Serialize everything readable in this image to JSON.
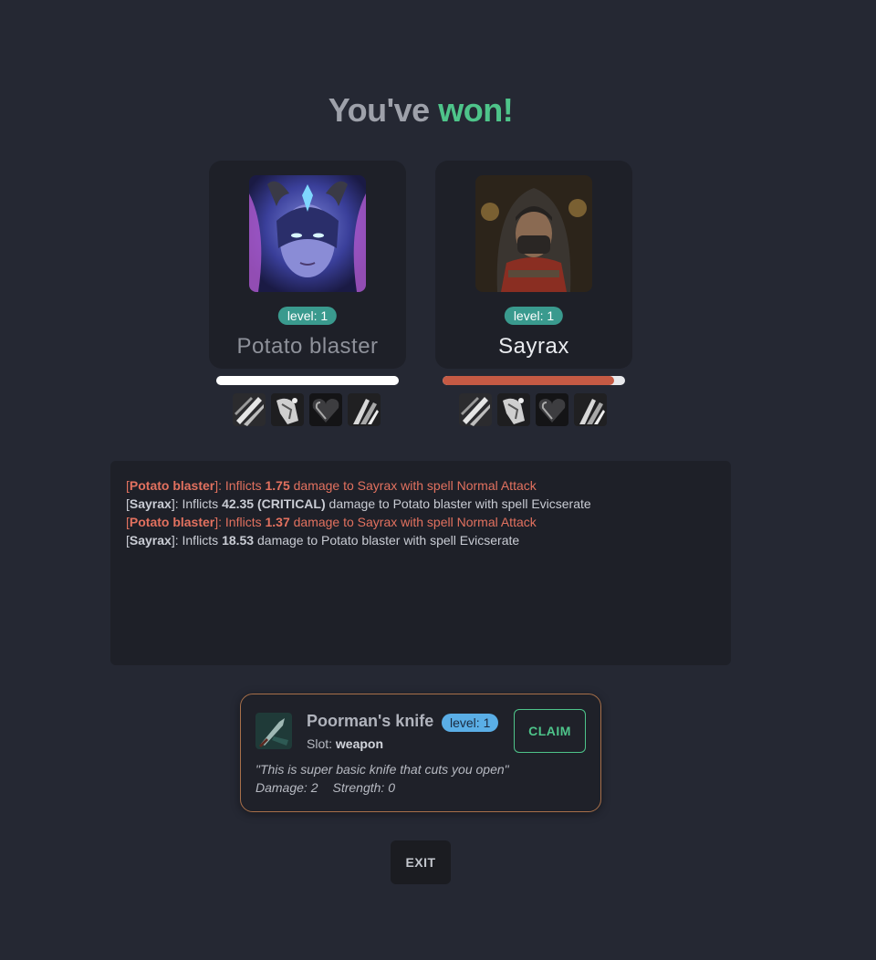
{
  "header": {
    "title_part1": "You've",
    "title_part2": "won!"
  },
  "colors": {
    "win": "#4ec48a",
    "hp_player": "#ffffff",
    "hp_enemy": "#c55a44",
    "loot_border": "#a8704a"
  },
  "player": {
    "name": "Potato blaster",
    "level_label": "level: 1",
    "hp_fraction": 1.0,
    "portrait_icon": "horned-sorceress-portrait",
    "spells": [
      "slash-icon",
      "grapple-icon",
      "heart-shield-icon",
      "claw-icon"
    ]
  },
  "enemy": {
    "name": "Sayrax",
    "level_label": "level: 1",
    "hp_fraction": 0.94,
    "portrait_icon": "hooded-rogue-portrait",
    "spells": [
      "slash-icon",
      "grapple-icon",
      "heart-shield-icon",
      "claw-icon"
    ]
  },
  "combat_log": [
    {
      "side": "ally",
      "open": "[",
      "actor": "Potato blaster",
      "mid": "]: Inflicts ",
      "amount": "1.75",
      "rest": " damage to Sayrax with spell Normal Attack"
    },
    {
      "side": "enemy",
      "open": "[",
      "actor": "Sayrax",
      "mid": "]: Inflicts ",
      "amount": "42.35 (CRITICAL)",
      "rest": " damage to Potato blaster with spell Evicserate"
    },
    {
      "side": "ally",
      "open": "[",
      "actor": "Potato blaster",
      "mid": "]: Inflicts ",
      "amount": "1.37",
      "rest": " damage to Sayrax with spell Normal Attack"
    },
    {
      "side": "enemy",
      "open": "[",
      "actor": "Sayrax",
      "mid": "]: Inflicts ",
      "amount": "18.53",
      "rest": " damage to Potato blaster with spell Evicserate"
    }
  ],
  "loot": {
    "icon": "knife-icon",
    "name": "Poorman's knife",
    "level_label": "level: 1",
    "slot_label": "Slot: ",
    "slot_value": "weapon",
    "claim_label": "CLAIM",
    "description": "\"This is super basic knife that cuts you open\"",
    "damage": "Damage: 2",
    "strength": "Strength: 0"
  },
  "exit_label": "EXIT"
}
